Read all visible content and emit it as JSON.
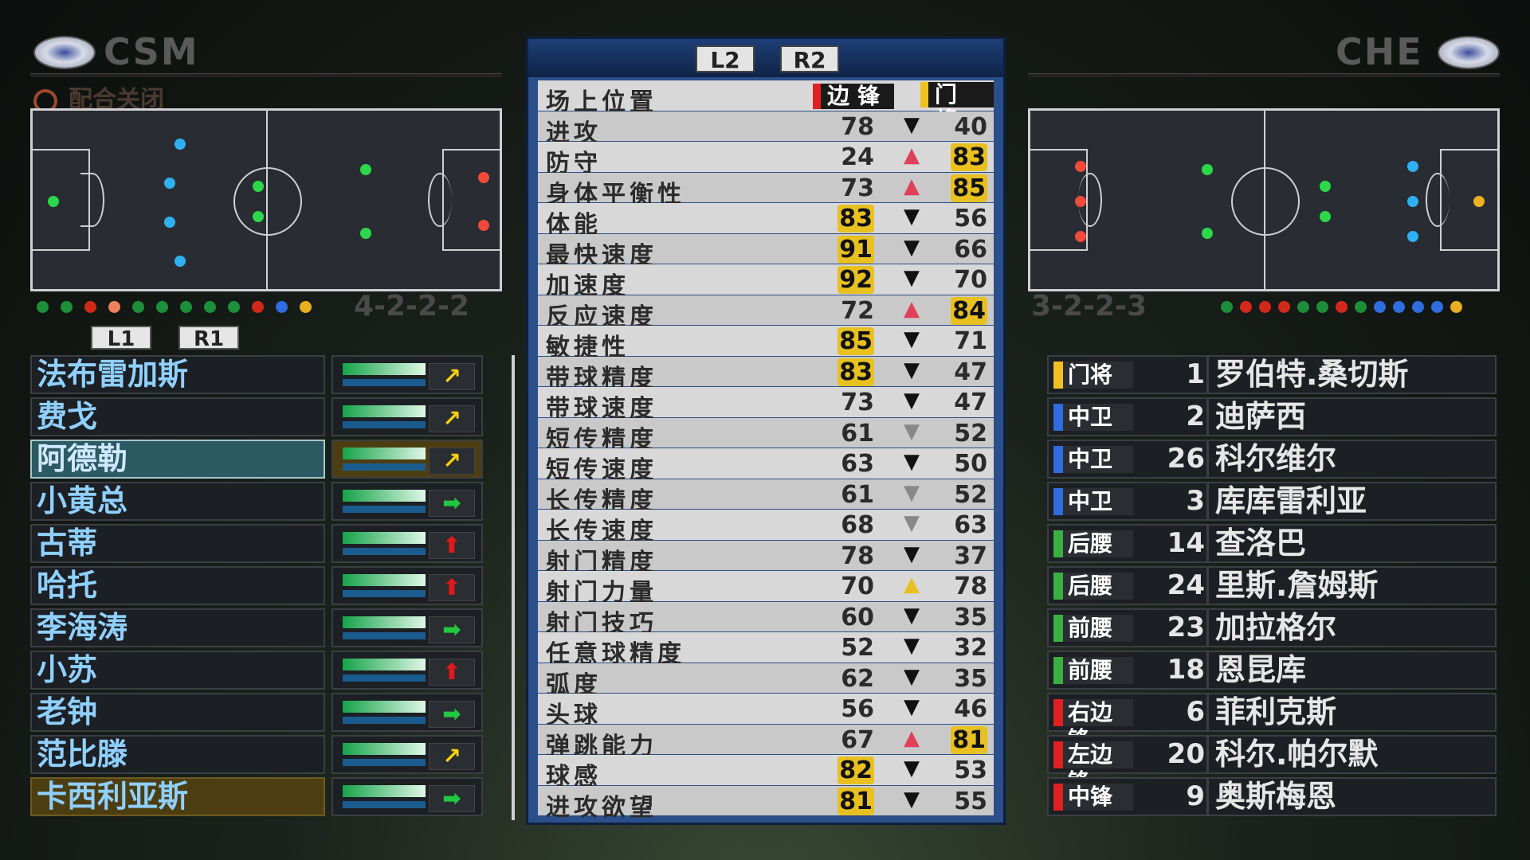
{
  "home": {
    "code": "CSM",
    "coop_status": "配合关闭",
    "formation": "4-2-2-2",
    "dot_colors": [
      "#1d8f3a",
      "#1d8f3a",
      "#d12a1a",
      "#f08060",
      "#1d8f3a",
      "#1d8f3a",
      "#1d8f3a",
      "#1d8f3a",
      "#1d8f3a",
      "#d12a1a",
      "#2f6de0",
      "#e8b020"
    ],
    "players": [
      {
        "name": "法布雷加斯",
        "form": "↗",
        "form_color": "#f5d30f"
      },
      {
        "name": "费戈",
        "form": "↗",
        "form_color": "#f5d30f"
      },
      {
        "name": "阿德勒",
        "form": "↗",
        "form_color": "#f5d30f"
      },
      {
        "name": "小黄总",
        "form": "➡",
        "form_color": "#21c940"
      },
      {
        "name": "古蒂",
        "form": "⬆",
        "form_color": "#e01a1a"
      },
      {
        "name": "哈托",
        "form": "⬆",
        "form_color": "#e01a1a"
      },
      {
        "name": "李海涛",
        "form": "➡",
        "form_color": "#21c940"
      },
      {
        "name": "小苏",
        "form": "⬆",
        "form_color": "#e01a1a"
      },
      {
        "name": "老钟",
        "form": "➡",
        "form_color": "#21c940"
      },
      {
        "name": "范比滕",
        "form": "↗",
        "form_color": "#f5d30f"
      },
      {
        "name": "卡西利亚斯",
        "form": "➡",
        "form_color": "#21c940"
      }
    ]
  },
  "away": {
    "code": "CHE",
    "formation": "3-2-2-3",
    "dot_colors": [
      "#1d8f3a",
      "#d12a1a",
      "#d12a1a",
      "#d12a1a",
      "#1d8f3a",
      "#1d8f3a",
      "#d12a1a",
      "#1d8f3a",
      "#2f6de0",
      "#2f6de0",
      "#2f6de0",
      "#2f6de0",
      "#e8b020"
    ],
    "players": [
      {
        "pos": "门将",
        "num": "1",
        "name": "罗伯特.桑切斯",
        "pos_color": "#f0c020"
      },
      {
        "pos": "中卫",
        "num": "2",
        "name": "迪萨西",
        "pos_color": "#2f6de0"
      },
      {
        "pos": "中卫",
        "num": "26",
        "name": "科尔维尔",
        "pos_color": "#2f6de0"
      },
      {
        "pos": "中卫",
        "num": "3",
        "name": "库库雷利亚",
        "pos_color": "#2f6de0"
      },
      {
        "pos": "后腰",
        "num": "14",
        "name": "查洛巴",
        "pos_color": "#3ab040"
      },
      {
        "pos": "后腰",
        "num": "24",
        "name": "里斯.詹姆斯",
        "pos_color": "#3ab040"
      },
      {
        "pos": "前腰",
        "num": "23",
        "name": "加拉格尔",
        "pos_color": "#3ab040"
      },
      {
        "pos": "前腰",
        "num": "18",
        "name": "恩昆库",
        "pos_color": "#3ab040"
      },
      {
        "pos": "右边锋",
        "num": "6",
        "name": "菲利克斯",
        "pos_color": "#e02020"
      },
      {
        "pos": "左边锋",
        "num": "20",
        "name": "科尔.帕尔默",
        "pos_color": "#e02020"
      },
      {
        "pos": "中锋",
        "num": "9",
        "name": "奥斯梅恩",
        "pos_color": "#e02020"
      }
    ]
  },
  "buttons": {
    "l1": "L1",
    "r1": "R1",
    "l2": "L2",
    "r2": "R2"
  },
  "compare": {
    "position_label": "场上位置",
    "pos_left": "边锋",
    "pos_right": "门将",
    "rows": [
      {
        "label": "进攻",
        "v1": "78",
        "arrow": "▼",
        "arrow_color": "#111",
        "v2": "40",
        "hl1": false,
        "hl2": false
      },
      {
        "label": "防守",
        "v1": "24",
        "arrow": "▲",
        "arrow_color": "#e0405a",
        "v2": "83",
        "hl1": false,
        "hl2": true
      },
      {
        "label": "身体平衡性",
        "v1": "73",
        "arrow": "▲",
        "arrow_color": "#e0405a",
        "v2": "85",
        "hl1": false,
        "hl2": true
      },
      {
        "label": "体能",
        "v1": "83",
        "arrow": "▼",
        "arrow_color": "#111",
        "v2": "56",
        "hl1": true,
        "hl2": false
      },
      {
        "label": "最快速度",
        "v1": "91",
        "arrow": "▼",
        "arrow_color": "#111",
        "v2": "66",
        "hl1": true,
        "hl2": false
      },
      {
        "label": "加速度",
        "v1": "92",
        "arrow": "▼",
        "arrow_color": "#111",
        "v2": "70",
        "hl1": true,
        "hl2": false
      },
      {
        "label": "反应速度",
        "v1": "72",
        "arrow": "▲",
        "arrow_color": "#e0405a",
        "v2": "84",
        "hl1": false,
        "hl2": true
      },
      {
        "label": "敏捷性",
        "v1": "85",
        "arrow": "▼",
        "arrow_color": "#111",
        "v2": "71",
        "hl1": true,
        "hl2": false
      },
      {
        "label": "带球精度",
        "v1": "83",
        "arrow": "▼",
        "arrow_color": "#111",
        "v2": "47",
        "hl1": true,
        "hl2": false
      },
      {
        "label": "带球速度",
        "v1": "73",
        "arrow": "▼",
        "arrow_color": "#111",
        "v2": "47",
        "hl1": false,
        "hl2": false
      },
      {
        "label": "短传精度",
        "v1": "61",
        "arrow": "▼",
        "arrow_color": "#888",
        "v2": "52",
        "hl1": false,
        "hl2": false
      },
      {
        "label": "短传速度",
        "v1": "63",
        "arrow": "▼",
        "arrow_color": "#111",
        "v2": "50",
        "hl1": false,
        "hl2": false
      },
      {
        "label": "长传精度",
        "v1": "61",
        "arrow": "▼",
        "arrow_color": "#888",
        "v2": "52",
        "hl1": false,
        "hl2": false
      },
      {
        "label": "长传速度",
        "v1": "68",
        "arrow": "▼",
        "arrow_color": "#888",
        "v2": "63",
        "hl1": false,
        "hl2": false
      },
      {
        "label": "射门精度",
        "v1": "78",
        "arrow": "▼",
        "arrow_color": "#111",
        "v2": "37",
        "hl1": false,
        "hl2": false
      },
      {
        "label": "射门力量",
        "v1": "70",
        "arrow": "▲",
        "arrow_color": "#e8c020",
        "v2": "78",
        "hl1": false,
        "hl2": false
      },
      {
        "label": "射门技巧",
        "v1": "60",
        "arrow": "▼",
        "arrow_color": "#111",
        "v2": "35",
        "hl1": false,
        "hl2": false
      },
      {
        "label": "任意球精度",
        "v1": "52",
        "arrow": "▼",
        "arrow_color": "#111",
        "v2": "32",
        "hl1": false,
        "hl2": false
      },
      {
        "label": "弧度",
        "v1": "62",
        "arrow": "▼",
        "arrow_color": "#111",
        "v2": "35",
        "hl1": false,
        "hl2": false
      },
      {
        "label": "头球",
        "v1": "56",
        "arrow": "▼",
        "arrow_color": "#111",
        "v2": "46",
        "hl1": false,
        "hl2": false
      },
      {
        "label": "弹跳能力",
        "v1": "67",
        "arrow": "▲",
        "arrow_color": "#e0405a",
        "v2": "81",
        "hl1": false,
        "hl2": true
      },
      {
        "label": "球感",
        "v1": "82",
        "arrow": "▼",
        "arrow_color": "#111",
        "v2": "53",
        "hl1": true,
        "hl2": false
      },
      {
        "label": "进攻欲望",
        "v1": "81",
        "arrow": "▼",
        "arrow_color": "#111",
        "v2": "55",
        "hl1": true,
        "hl2": false
      }
    ]
  }
}
